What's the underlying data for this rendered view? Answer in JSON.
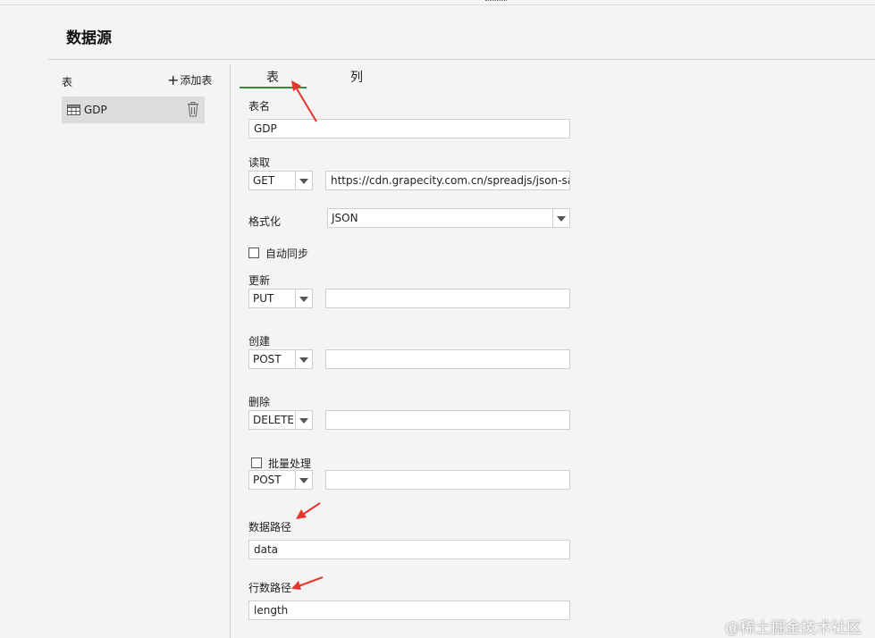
{
  "page": {
    "title": "数据源"
  },
  "sidebar": {
    "header": "表",
    "add_label": "添加表",
    "items": [
      {
        "name": "GDP"
      }
    ]
  },
  "tabs": [
    {
      "label": "表",
      "active": true
    },
    {
      "label": "列",
      "active": false
    }
  ],
  "form": {
    "table_name": {
      "label": "表名",
      "value": "GDP"
    },
    "read": {
      "label": "读取",
      "method": "GET",
      "url": "https://cdn.grapecity.com.cn/spreadjs/json-sampl"
    },
    "format": {
      "label": "格式化",
      "value": "JSON"
    },
    "auto_sync": {
      "label": "自动同步",
      "checked": false
    },
    "update": {
      "label": "更新",
      "method": "PUT",
      "url": ""
    },
    "create": {
      "label": "创建",
      "method": "POST",
      "url": ""
    },
    "delete": {
      "label": "删除",
      "method": "DELETE",
      "url": ""
    },
    "batch": {
      "label": "批量处理",
      "checked": false,
      "method": "POST",
      "url": ""
    },
    "data_path": {
      "label": "数据路径",
      "value": "data"
    },
    "row_count_path": {
      "label": "行数路径",
      "value": "length"
    }
  },
  "colors": {
    "accent_underline": "#3a8a3a",
    "annotation_arrow": "#e8352c",
    "selected_item_bg": "#dcdcdc"
  },
  "watermark": "@稀土掘金技术社区"
}
